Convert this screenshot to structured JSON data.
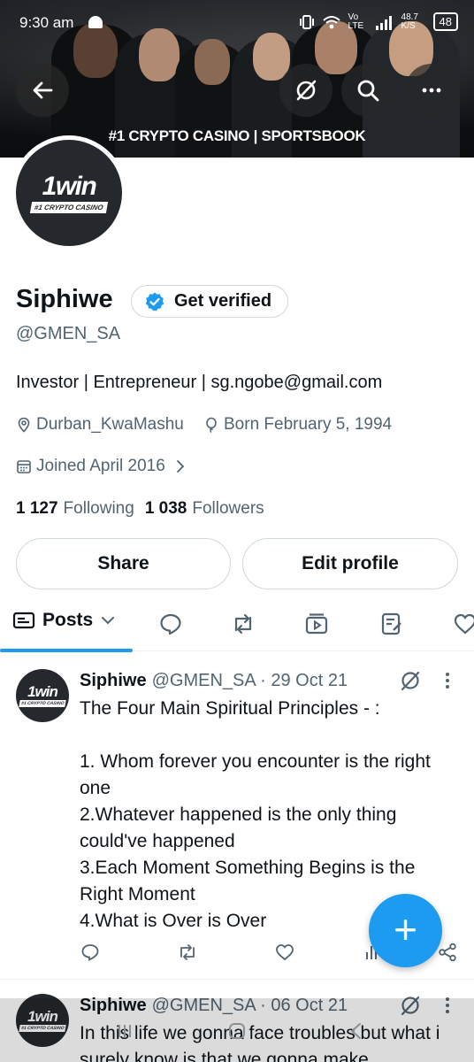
{
  "status_bar": {
    "time": "9:30 am",
    "network": "Vo LTE",
    "speed": "48.7 K/S",
    "battery": "48"
  },
  "banner": {
    "caption": "#1 CRYPTO CASINO | SPORTSBOOK"
  },
  "avatar": {
    "brand": "1win",
    "tagline": "#1 CRYPTO CASINO"
  },
  "profile": {
    "name": "Siphiwe",
    "get_verified_label": "Get verified",
    "handle": "@GMEN_SA",
    "bio": "Investor | Entrepreneur | sg.ngobe@gmail.com",
    "location": "Durban_KwaMashu",
    "born": "Born February 5, 1994",
    "joined": "Joined April 2016",
    "following_count": "1 127",
    "following_label": "Following",
    "followers_count": "1 038",
    "followers_label": "Followers"
  },
  "buttons": {
    "share": "Share",
    "edit_profile": "Edit profile"
  },
  "tabs": {
    "posts": "Posts"
  },
  "posts": [
    {
      "name": "Siphiwe",
      "handle": "@GMEN_SA",
      "date": "· 29 Oct 21",
      "text": "The Four Main Spiritual Principles - :\n\n1. Whom forever you encounter is the right one\n2.Whatever happened is the only thing could've happened\n3.Each Moment Something Begins is the Right Moment\n4.What is Over is Over"
    },
    {
      "name": "Siphiwe",
      "handle": "@GMEN_SA",
      "date": "· 06 Oct 21",
      "text": "In this life we gonna face troubles but what i surely know is that we gonna make"
    }
  ],
  "colors": {
    "accent": "#1d9bf0",
    "text": "#0f1419",
    "muted": "#536471",
    "border": "#cfd9de"
  }
}
